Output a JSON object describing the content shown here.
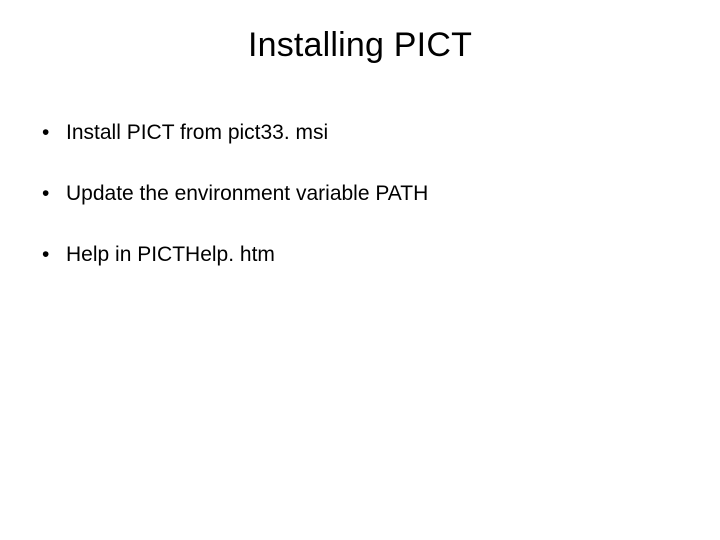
{
  "slide": {
    "title": "Installing PICT",
    "bullets": [
      "Install PICT from pict33. msi",
      "Update the environment variable PATH",
      "Help in PICTHelp. htm"
    ]
  }
}
